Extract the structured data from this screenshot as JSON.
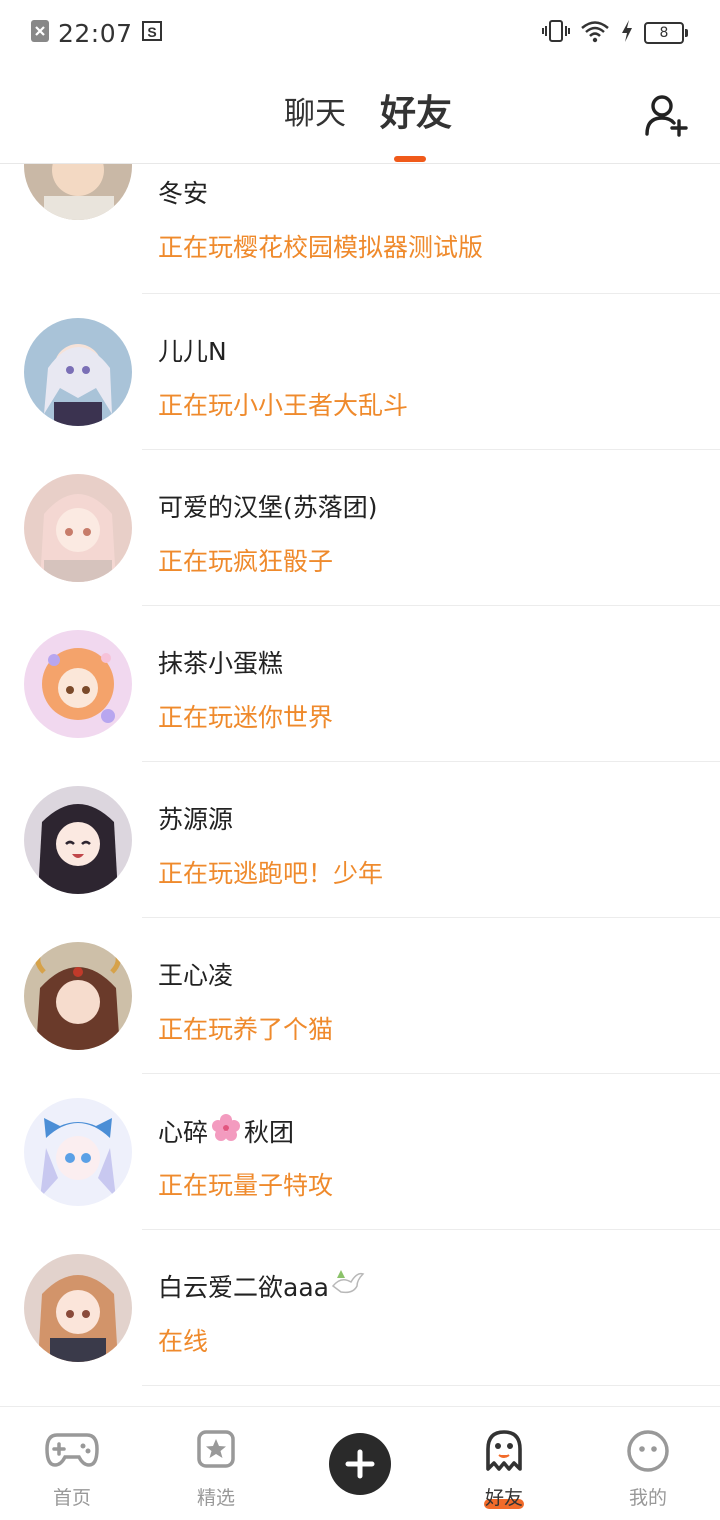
{
  "status_bar": {
    "time": "22:07",
    "battery": "8"
  },
  "header": {
    "tabs": [
      {
        "label": "聊天",
        "active": false
      },
      {
        "label": "好友",
        "active": true
      }
    ],
    "accent_color": "#f05a1a"
  },
  "friends": [
    {
      "name": "冬安",
      "status": "正在玩樱花校园模拟器测试版"
    },
    {
      "name": "儿儿N",
      "status": "正在玩小小王者大乱斗"
    },
    {
      "name": "可爱的汉堡(苏落团)",
      "status": "正在玩疯狂骰子"
    },
    {
      "name": "抹茶小蛋糕",
      "status": "正在玩迷你世界"
    },
    {
      "name": "苏源源",
      "status": "正在玩逃跑吧！少年"
    },
    {
      "name": "王心凌",
      "status": "正在玩养了个猫"
    },
    {
      "name": "心碎",
      "name_suffix": "秋团",
      "status": "正在玩量子特攻"
    },
    {
      "name": "白云爱二欲aaa",
      "status": "在线"
    }
  ],
  "status_color": "#ef8a2c",
  "nav": {
    "items": [
      {
        "label": "首页",
        "icon": "gamepad-icon"
      },
      {
        "label": "精选",
        "icon": "star-icon"
      },
      {
        "label": "",
        "icon": "plus-icon"
      },
      {
        "label": "好友",
        "icon": "ghost-icon",
        "active": true
      },
      {
        "label": "我的",
        "icon": "face-icon"
      }
    ]
  }
}
